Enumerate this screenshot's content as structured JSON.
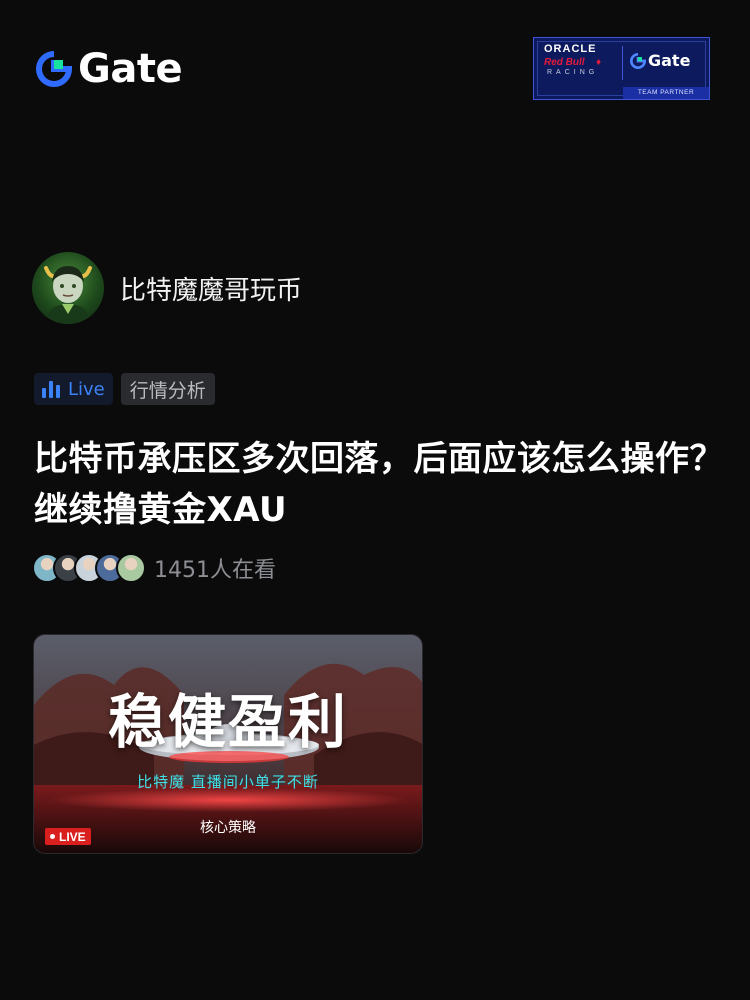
{
  "brand": {
    "name": "Gate",
    "icon": "gate-logo-icon"
  },
  "partner_badge": {
    "line1": "ORACLE",
    "line2": "Red Bull",
    "line3": "RACING",
    "gate": "Gate",
    "team": "TEAM PARTNER"
  },
  "author": {
    "name": "比特魔魔哥玩币",
    "avatar": "avatar-icon"
  },
  "tags": {
    "live_label": "Live",
    "category": "行情分析"
  },
  "post": {
    "title": "比特币承压区多次回落，后面应该怎么操作？继续撸黄金XAU"
  },
  "viewers": {
    "count_text": "1451人在看",
    "avatar_colors": [
      "#7fb6c8",
      "#3b3f46",
      "#c9d3dc",
      "#4d6b9a",
      "#a9c9a0"
    ]
  },
  "thumbnail": {
    "headline": "稳健盈利",
    "subtitle": "比特魔  直播间小单子不断",
    "strategy": "核心策略",
    "live_badge": "LIVE"
  },
  "colors": {
    "accent_blue": "#3b82f6",
    "brand_green": "#17e3a1",
    "live_red": "#d9201f"
  }
}
